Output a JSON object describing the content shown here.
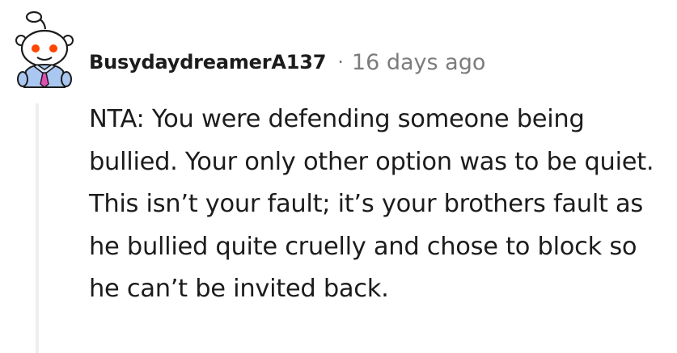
{
  "comment": {
    "avatar_icon": "reddit-snoo-avatar",
    "username": "BusydaydreamerA137",
    "separator": "·",
    "timestamp": "16 days ago",
    "body": "NTA: You were defending someone being bullied. Your only other option was to be quiet. This isn’t your fault; it’s your brothers fault as he bullied quite cruelly and chose to block so he can’t be invited back."
  },
  "colors": {
    "text": "#1c1c1c",
    "meta": "#7c7c7c",
    "thread_line": "#edeff1",
    "snoo_accent": "#ff4500"
  }
}
